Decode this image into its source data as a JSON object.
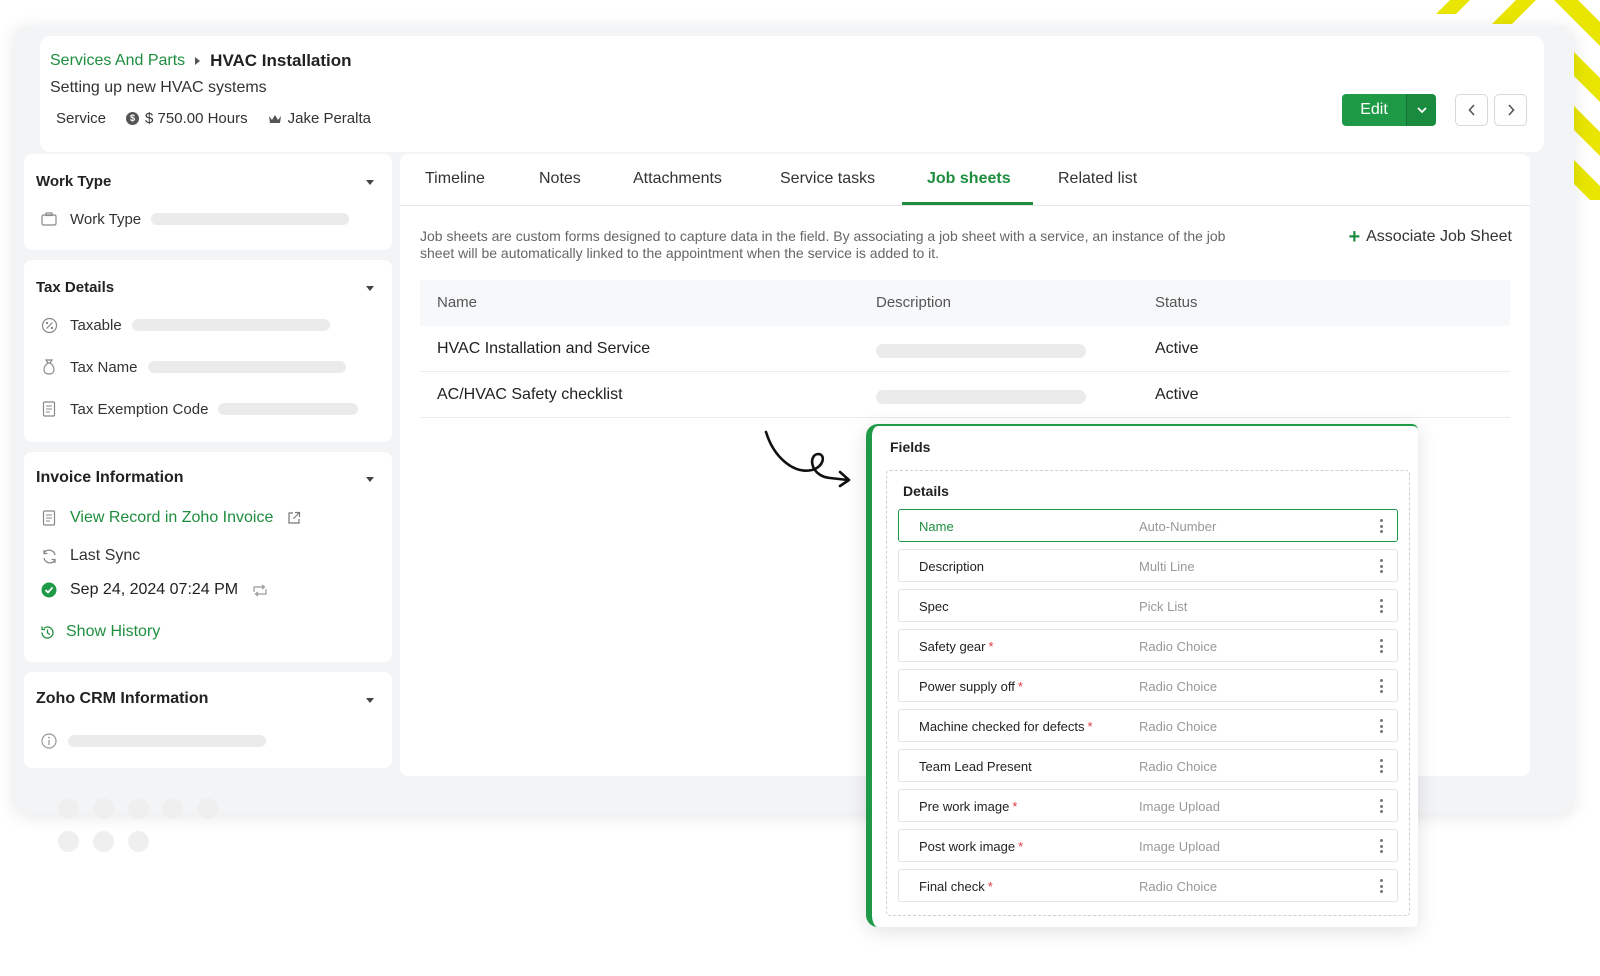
{
  "header": {
    "breadcrumb_parent": "Services And Parts",
    "breadcrumb_current": "HVAC Installation",
    "subtitle": "Setting up new HVAC systems",
    "type": "Service",
    "price": "$ 750.00 Hours",
    "owner": "Jake Peralta",
    "edit_label": "Edit"
  },
  "sidebar": {
    "work_type": {
      "title": "Work Type",
      "field": "Work Type"
    },
    "tax_details": {
      "title": "Tax Details",
      "fields": [
        "Taxable",
        "Tax Name",
        "Tax Exemption Code"
      ]
    },
    "invoice": {
      "title": "Invoice Information",
      "view_record": "View Record in Zoho Invoice",
      "last_sync": "Last Sync",
      "sync_time": "Sep 24, 2024 07:24 PM",
      "show_history": "Show History"
    },
    "crm": {
      "title": "Zoho CRM Information"
    }
  },
  "tabs": [
    "Timeline",
    "Notes",
    "Attachments",
    "Service tasks",
    "Job sheets",
    "Related list"
  ],
  "active_tab": "Job sheets",
  "job_sheets": {
    "description": "Job sheets are custom forms designed to capture data in the field. By associating a job sheet with a service, an instance of the job sheet will be automatically linked to the appointment when the service is added to it.",
    "associate_label": "Associate Job Sheet",
    "columns": [
      "Name",
      "Description",
      "Status"
    ],
    "rows": [
      {
        "name": "HVAC Installation and Service",
        "status": "Active"
      },
      {
        "name": "AC/HVAC Safety checklist",
        "status": "Active"
      }
    ]
  },
  "fields_panel": {
    "title": "Fields",
    "section": "Details",
    "fields": [
      {
        "name": "Name",
        "type": "Auto-Number",
        "required": false
      },
      {
        "name": "Description",
        "type": "Multi Line",
        "required": false
      },
      {
        "name": "Spec",
        "type": "Pick List",
        "required": false
      },
      {
        "name": "Safety gear",
        "type": "Radio Choice",
        "required": true
      },
      {
        "name": "Power supply off",
        "type": "Radio Choice",
        "required": true
      },
      {
        "name": "Machine checked for defects",
        "type": "Radio Choice",
        "required": true
      },
      {
        "name": "Team Lead Present",
        "type": "Radio Choice",
        "required": false
      },
      {
        "name": "Pre work image",
        "type": "Image Upload",
        "required": true
      },
      {
        "name": "Post work image",
        "type": "Image Upload",
        "required": true
      },
      {
        "name": "Final check",
        "type": "Radio Choice",
        "required": true
      }
    ]
  },
  "colors": {
    "accent": "#1e9a47",
    "stripe": "#e6e600"
  }
}
